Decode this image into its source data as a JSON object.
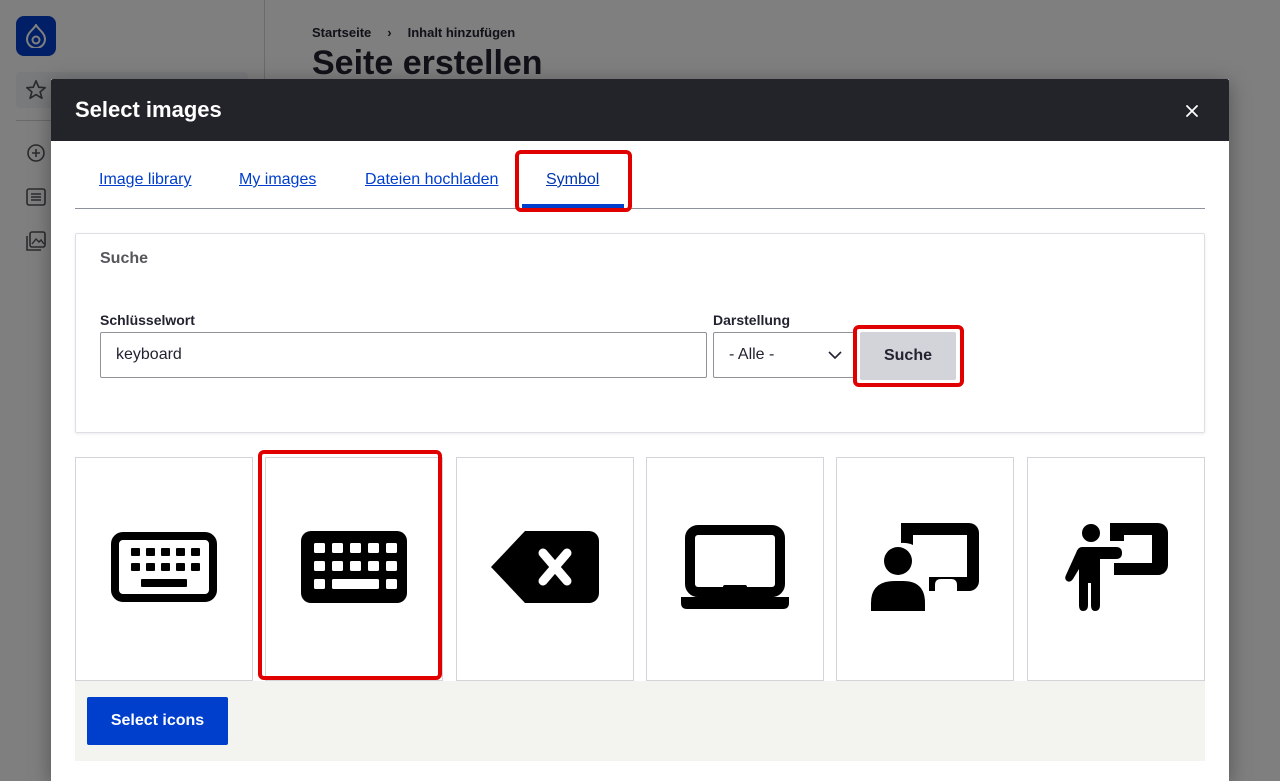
{
  "background": {
    "breadcrumb": {
      "home": "Startseite",
      "separator": "›",
      "current": "Inhalt hinzufügen"
    },
    "page_title": "Seite erstellen"
  },
  "dialog": {
    "title": "Select images",
    "close_icon": "close-icon",
    "tabs": [
      {
        "label": "Image library"
      },
      {
        "label": "My images"
      },
      {
        "label": "Dateien hochladen"
      },
      {
        "label": "Symbol",
        "active": true
      }
    ],
    "search": {
      "legend": "Suche",
      "keyword_label": "Schlüsselwort",
      "keyword_value": "keyboard",
      "display_label": "Darstellung",
      "display_value": "- Alle -",
      "button_label": "Suche"
    },
    "icons": [
      {
        "name": "keyboard-outline-icon"
      },
      {
        "name": "keyboard-filled-icon",
        "selected": true
      },
      {
        "name": "backspace-icon"
      },
      {
        "name": "laptop-icon"
      },
      {
        "name": "chalkboard-user-icon"
      },
      {
        "name": "person-chalkboard-icon"
      }
    ],
    "select_button_label": "Select icons"
  },
  "colors": {
    "accent": "#003ecc",
    "highlight": "#e00000",
    "header_bg": "#232429"
  }
}
